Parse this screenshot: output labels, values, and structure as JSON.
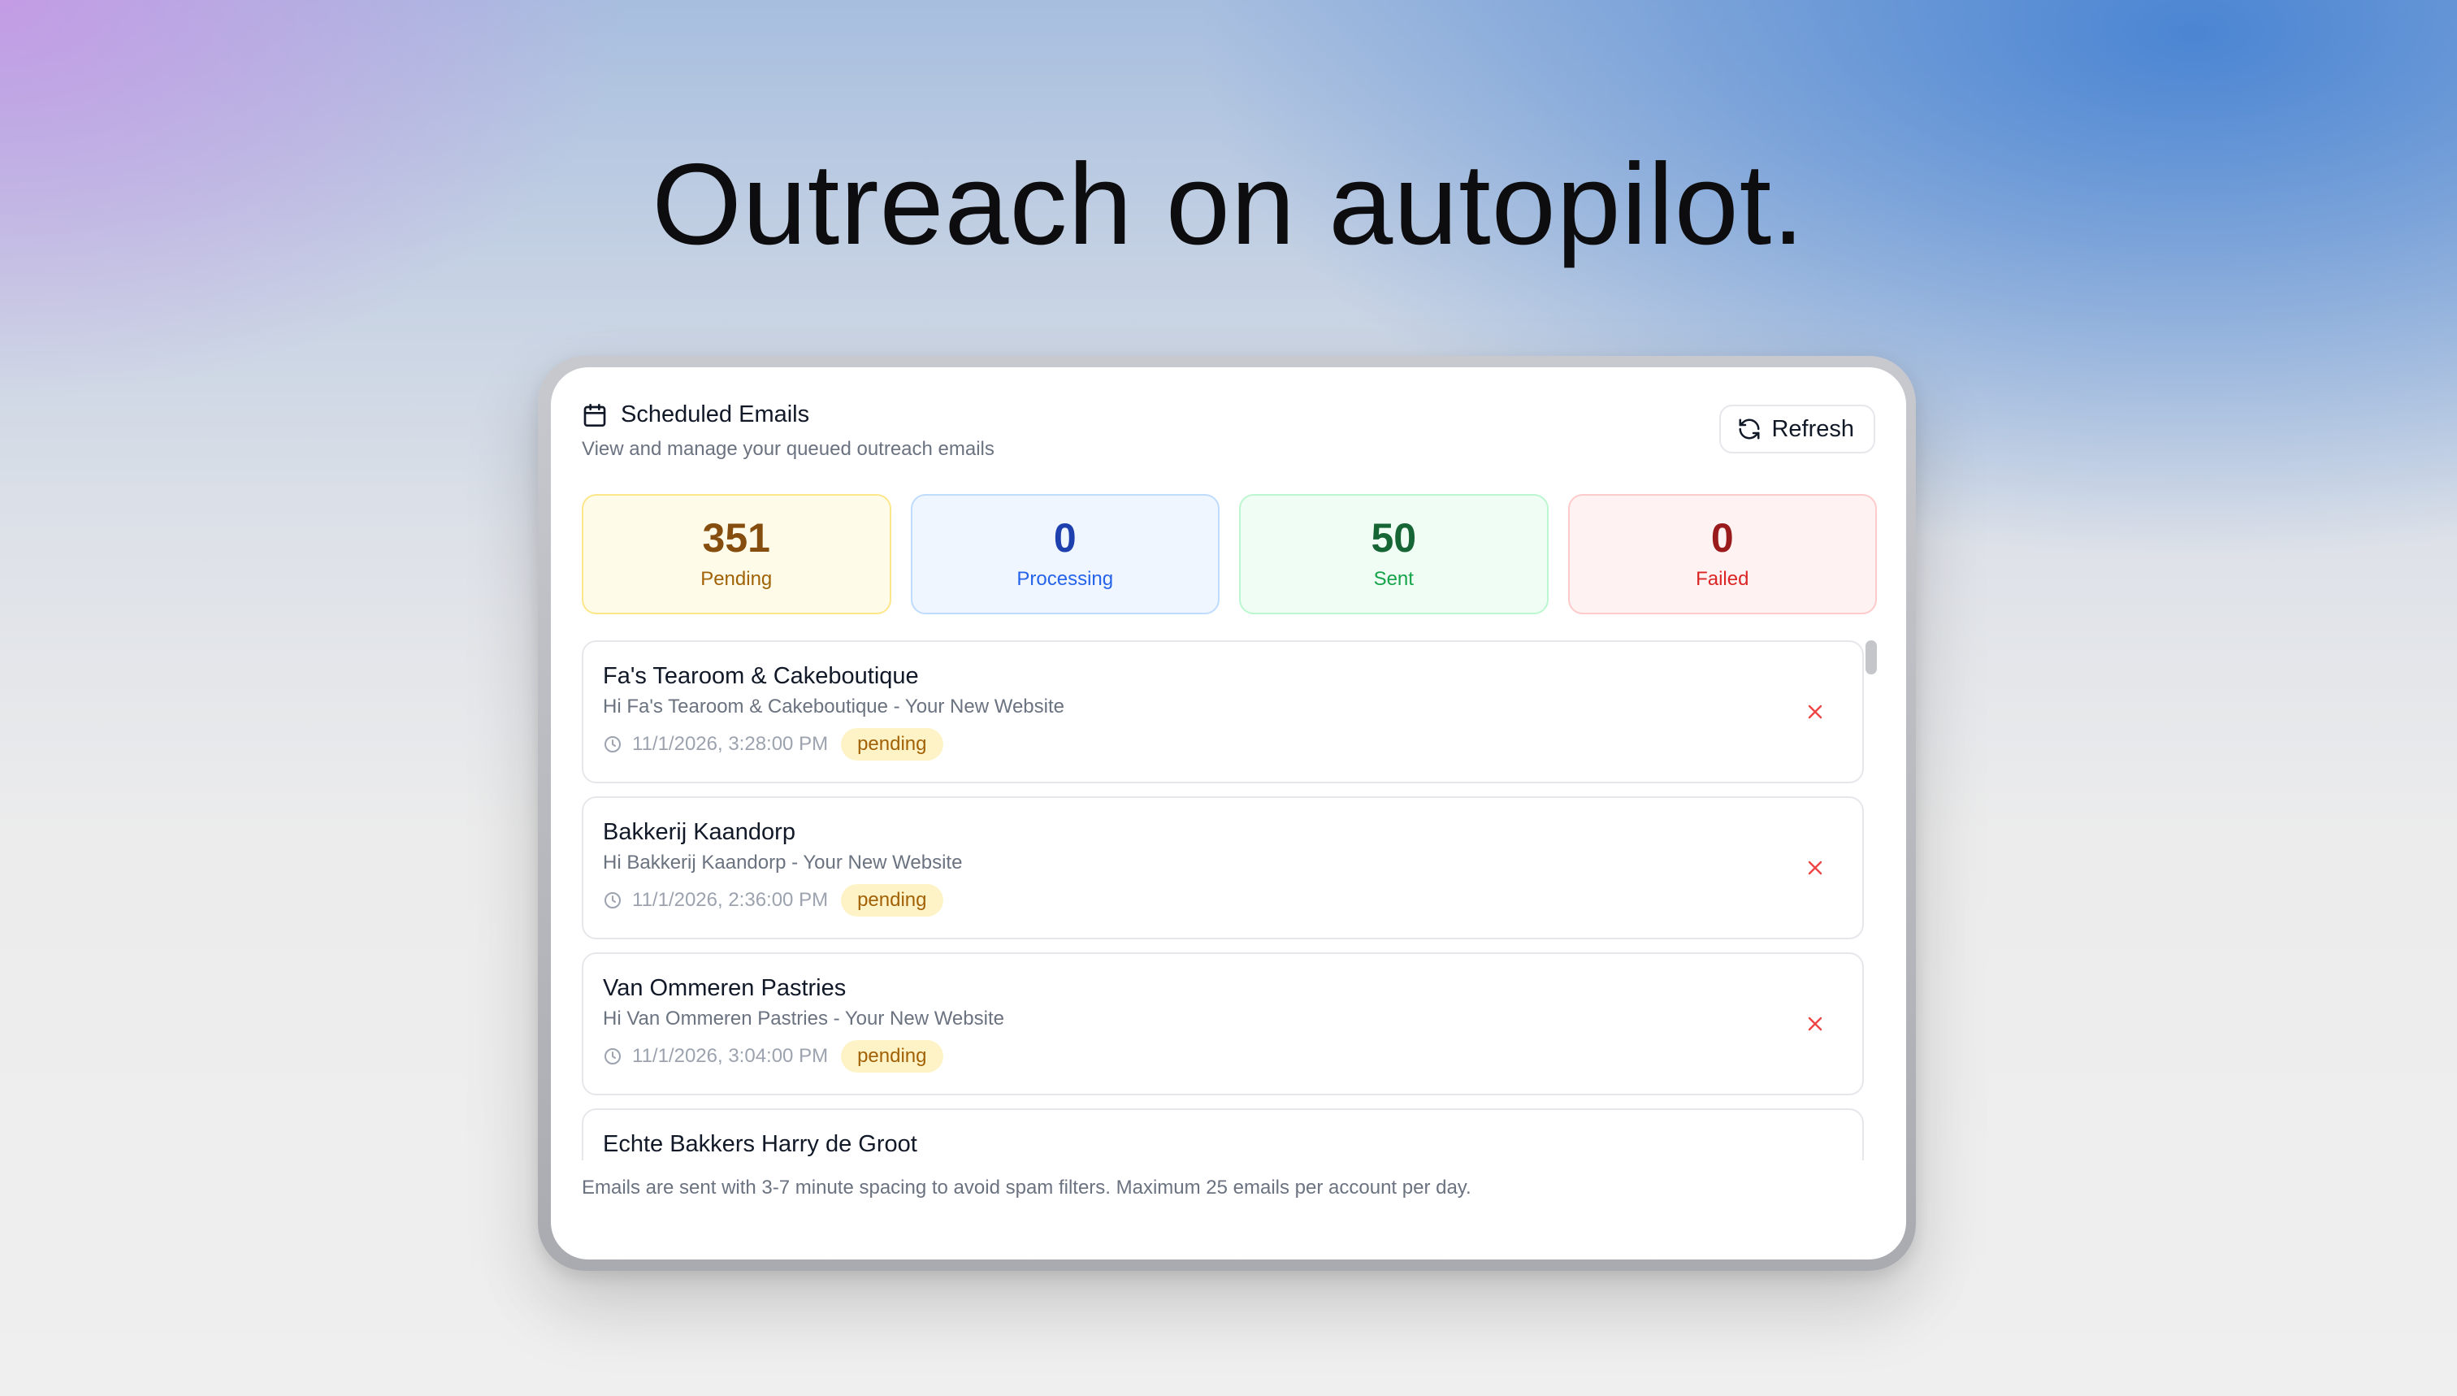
{
  "headline": "Outreach on autopilot.",
  "card": {
    "title": "Scheduled Emails",
    "subtitle": "View and manage your queued outreach emails",
    "refresh_label": "Refresh"
  },
  "stats": [
    {
      "value": "351",
      "label": "Pending",
      "color": "#854d0e"
    },
    {
      "value": "0",
      "label": "Processing",
      "color": "#1e40af"
    },
    {
      "value": "50",
      "label": "Sent",
      "color": "#166534"
    },
    {
      "value": "0",
      "label": "Failed",
      "color": "#991b1b"
    }
  ],
  "emails": [
    {
      "name": "Fa's Tearoom & Cakeboutique",
      "subject": "Hi Fa's Tearoom & Cakeboutique - Your New Website",
      "time": "11/1/2026, 3:28:00 PM",
      "status": "pending"
    },
    {
      "name": "Bakkerij Kaandorp",
      "subject": "Hi Bakkerij Kaandorp - Your New Website",
      "time": "11/1/2026, 2:36:00 PM",
      "status": "pending"
    },
    {
      "name": "Van Ommeren Pastries",
      "subject": "Hi Van Ommeren Pastries - Your New Website",
      "time": "11/1/2026, 3:04:00 PM",
      "status": "pending"
    },
    {
      "name": "Echte Bakkers Harry de Groot",
      "subject": "",
      "time": "",
      "status": ""
    }
  ],
  "footer_note": "Emails are sent with 3-7 minute spacing to avoid spam filters. Maximum 25 emails per account per day.",
  "icons": {
    "title": "calendar-icon",
    "refresh": "refresh-icon",
    "time": "clock-icon",
    "delete": "close-icon"
  },
  "colors": {
    "pending_badge_bg": "#fef3c7",
    "pending_badge_text": "#a16207",
    "delete": "#ef4444"
  }
}
